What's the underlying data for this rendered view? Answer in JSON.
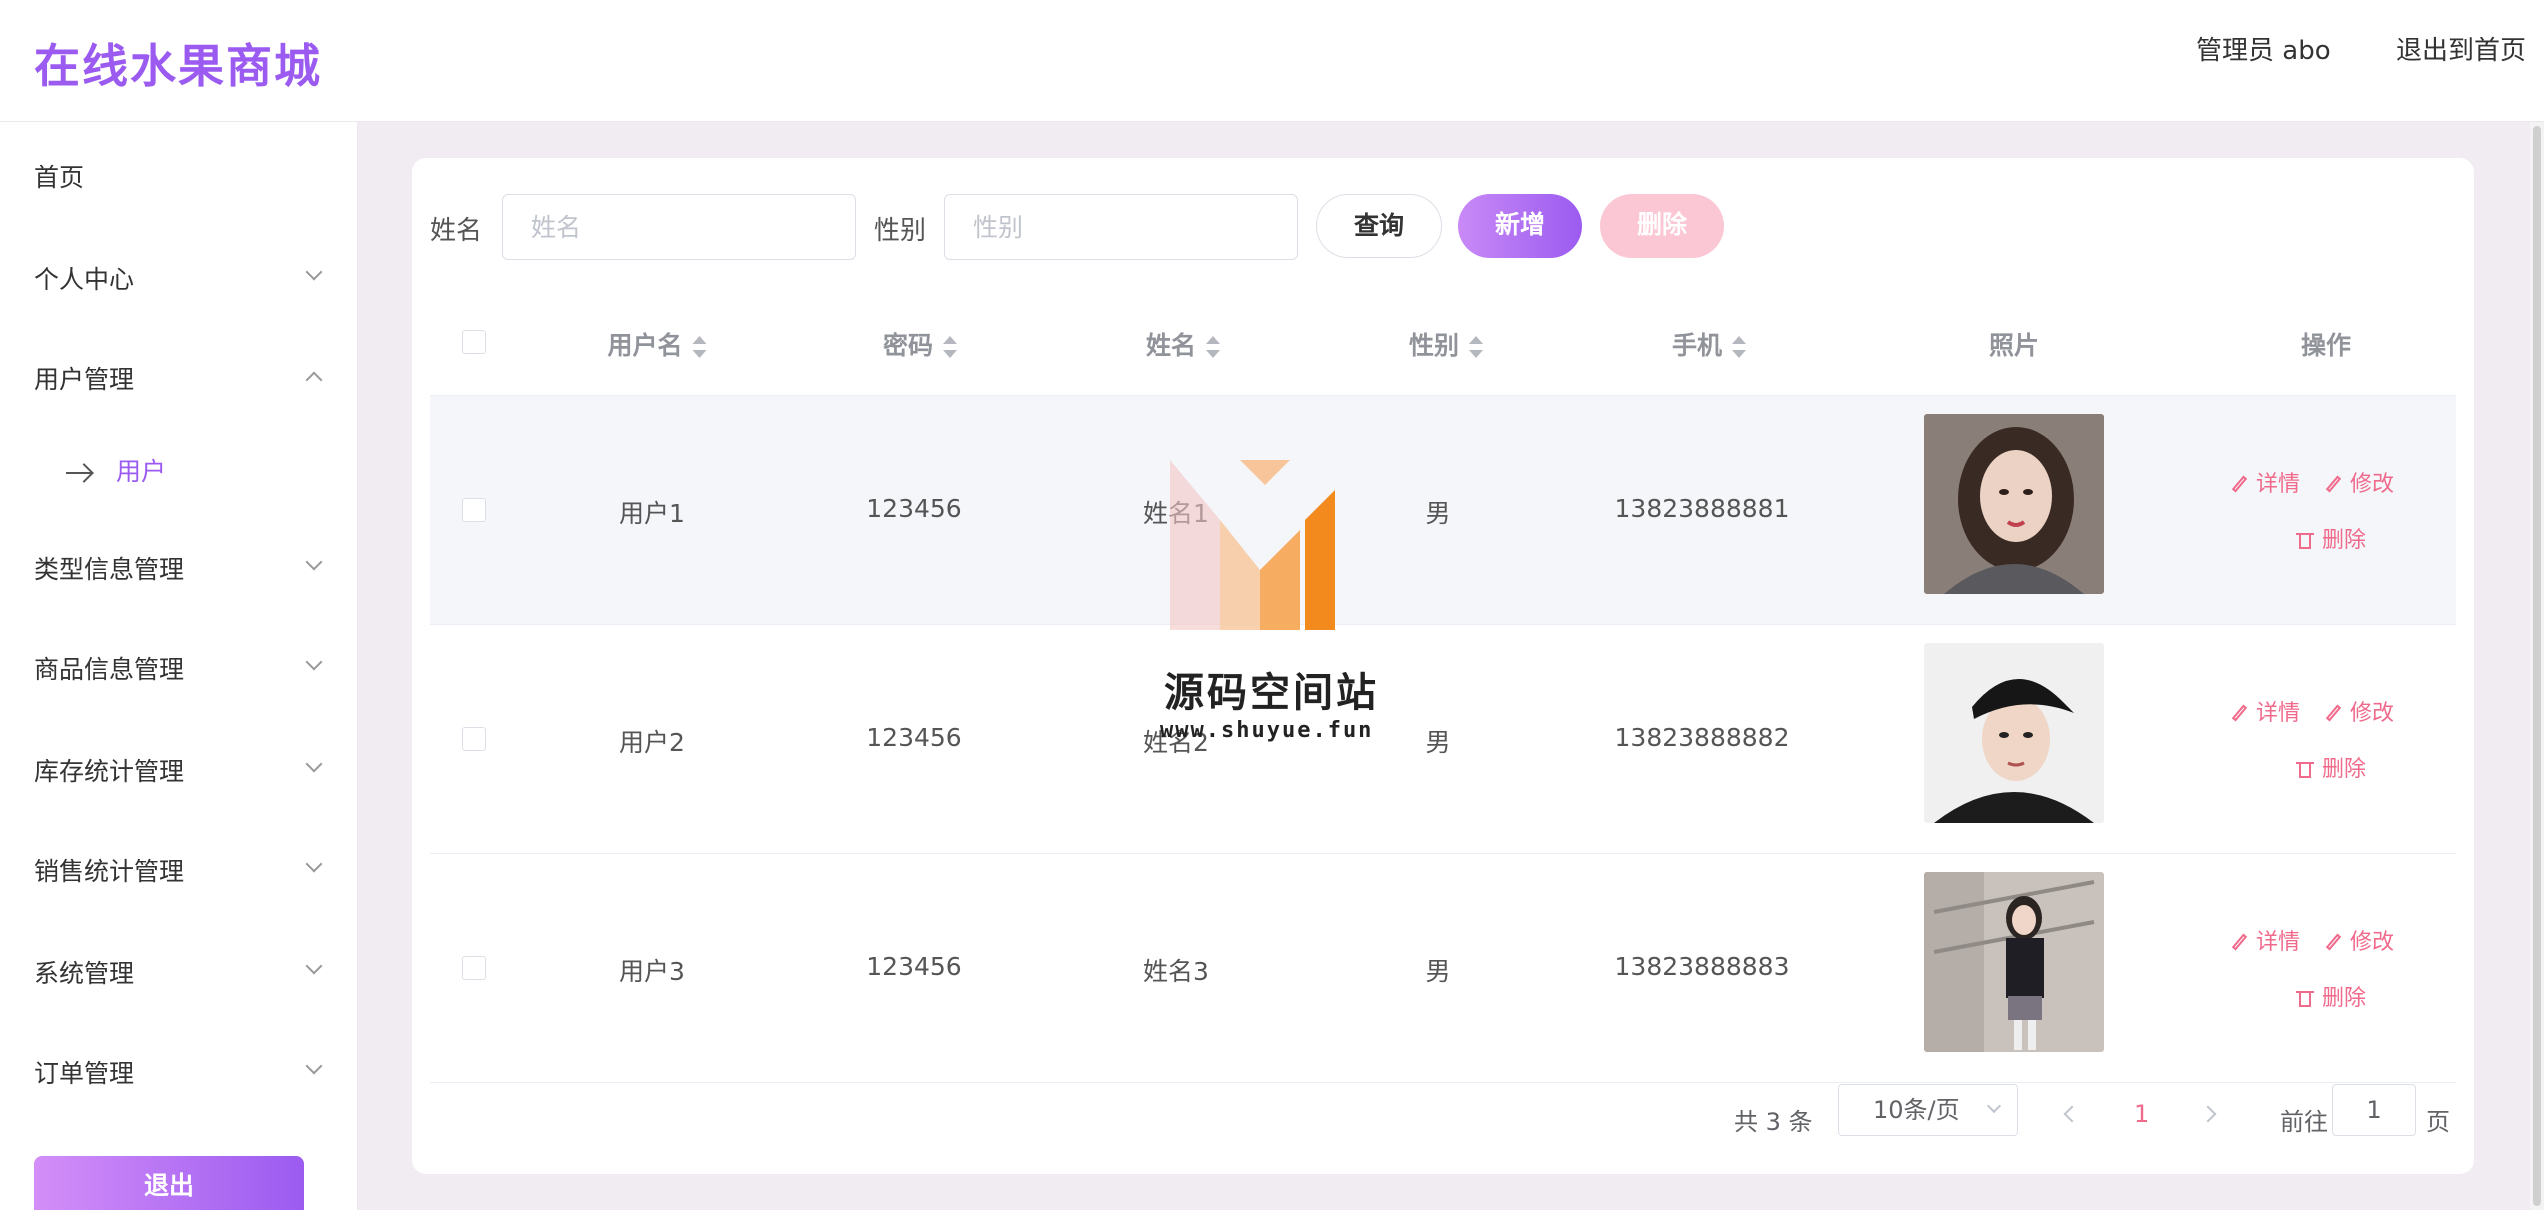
{
  "header": {
    "logo": "在线水果商城",
    "admin": "管理员 abo",
    "exit_home": "退出到首页"
  },
  "sidebar": {
    "items": [
      {
        "label": "首页"
      },
      {
        "label": "个人中心"
      },
      {
        "label": "用户管理"
      },
      {
        "label": "类型信息管理"
      },
      {
        "label": "商品信息管理"
      },
      {
        "label": "库存统计管理"
      },
      {
        "label": "销售统计管理"
      },
      {
        "label": "系统管理"
      },
      {
        "label": "订单管理"
      }
    ],
    "sub_item": "用户",
    "logout": "退出"
  },
  "search": {
    "name_label": "姓名",
    "name_placeholder": "姓名",
    "gender_label": "性别",
    "gender_placeholder": "性别",
    "query": "查询",
    "add": "新增",
    "delete": "删除"
  },
  "table": {
    "headers": [
      "用户名",
      "密码",
      "姓名",
      "性别",
      "手机",
      "照片",
      "操作"
    ],
    "rows": [
      {
        "username": "用户1",
        "password": "123456",
        "name": "姓名1",
        "gender": "男",
        "phone": "13823888881"
      },
      {
        "username": "用户2",
        "password": "123456",
        "name": "姓名2",
        "gender": "男",
        "phone": "13823888882"
      },
      {
        "username": "用户3",
        "password": "123456",
        "name": "姓名3",
        "gender": "男",
        "phone": "13823888883"
      }
    ],
    "actions": {
      "detail": "详情",
      "edit": "修改",
      "delete": "删除"
    }
  },
  "pagination": {
    "total": "共 3 条",
    "page_size": "10条/页",
    "current": "1",
    "goto_prefix": "前往",
    "goto_value": "1",
    "goto_suffix": "页"
  },
  "watermark": {
    "title": "源码空间站",
    "url": "www.shuyue.fun"
  },
  "colors": {
    "accent": "#9b5bf0",
    "danger": "#f06a8c",
    "delete_disabled": "#fbc7d4"
  }
}
